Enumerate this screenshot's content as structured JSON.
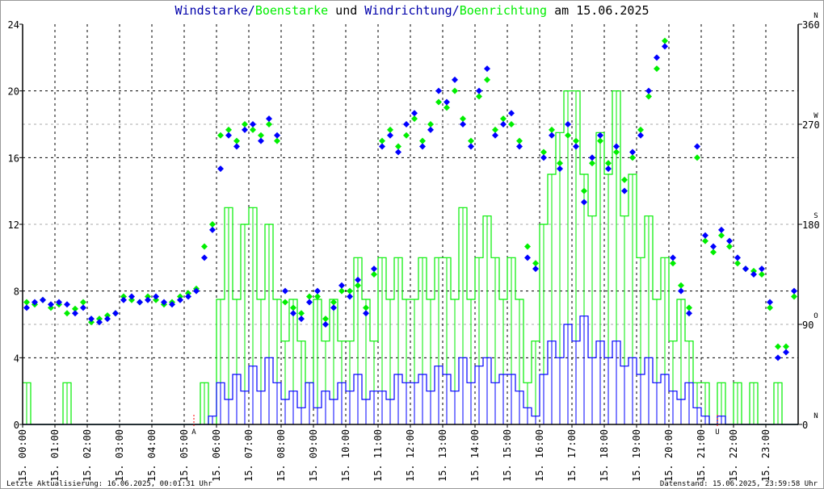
{
  "chart_data": {
    "type": "scatter",
    "title": {
      "parts": [
        {
          "text": "Windstarke",
          "color": "#0000aa"
        },
        {
          "text": "/",
          "color": "#0000aa"
        },
        {
          "text": "Boenstarke",
          "color": "#00ee00"
        },
        {
          "text": " und ",
          "color": "#000000"
        },
        {
          "text": "Windrichtung",
          "color": "#0000aa"
        },
        {
          "text": "/",
          "color": "#0000aa"
        },
        {
          "text": "Boenrichtung",
          "color": "#00ee00"
        },
        {
          "text": " am 15.06.2025",
          "color": "#000000"
        }
      ]
    },
    "x_unit": "hour",
    "xlim": [
      0,
      24
    ],
    "x_ticks": [
      "15. 00:00",
      "15. 01:00",
      "15. 02:00",
      "15. 03:00",
      "15. 04:00",
      "15. 05:00",
      "15. 06:00",
      "15. 07:00",
      "15. 08:00",
      "15. 09:00",
      "15. 10:00",
      "15. 11:00",
      "15. 12:00",
      "15. 13:00",
      "15. 14:00",
      "15. 15:00",
      "15. 16:00",
      "15. 17:00",
      "15. 18:00",
      "15. 19:00",
      "15. 20:00",
      "15. 21:00",
      "15. 22:00",
      "15. 23:00"
    ],
    "ylim_left": [
      0,
      24
    ],
    "y_ticks_left": [
      "0",
      "4",
      "8",
      "12",
      "16",
      "20",
      "24"
    ],
    "ylim_right": [
      0,
      360
    ],
    "y_ticks_right": [
      {
        "value": 0,
        "label": "0",
        "compass": "N"
      },
      {
        "value": 90,
        "label": "90",
        "compass": "O"
      },
      {
        "value": 180,
        "label": "180",
        "compass": "S"
      },
      {
        "value": 270,
        "label": "270",
        "compass": "W"
      },
      {
        "value": 360,
        "label": "360",
        "compass": "N"
      }
    ],
    "markers": [
      {
        "hour": 5.3,
        "label": "A",
        "color": "#ff0000"
      },
      {
        "hour": 21.5,
        "label": "U",
        "color": "#ff0000"
      }
    ],
    "sample_interval_minutes": 15,
    "series": [
      {
        "name": "Windstarke",
        "kind": "line",
        "axis": "left",
        "color": "#0000ff",
        "values": [
          0,
          0,
          0,
          0,
          0,
          0,
          0,
          0,
          0,
          0,
          0,
          0,
          0,
          0,
          0,
          0,
          0,
          0,
          0,
          0,
          0,
          0,
          0,
          0.5,
          2.5,
          1.5,
          3,
          2,
          3.5,
          2,
          4,
          2.5,
          1.5,
          2,
          1,
          2.5,
          1,
          2,
          1.5,
          2.5,
          2,
          3,
          1.5,
          2,
          2,
          1.5,
          3,
          2.5,
          2.5,
          3,
          2,
          3.5,
          3,
          2,
          4,
          2.5,
          3.5,
          4,
          2.5,
          3,
          3,
          2,
          1,
          0.5,
          3,
          5,
          4,
          6,
          5,
          6.5,
          4,
          5,
          4,
          5,
          3.5,
          4,
          3,
          4,
          2.5,
          3,
          2,
          1.5,
          2.5,
          1,
          0.5,
          0,
          0.5,
          0,
          0,
          0,
          0,
          0,
          0,
          0,
          0,
          0
        ]
      },
      {
        "name": "Boenstarke",
        "kind": "line",
        "axis": "left",
        "color": "#00ee00",
        "values": [
          2.5,
          0,
          0,
          0,
          0,
          2.5,
          0,
          0,
          0,
          0,
          0,
          0,
          0,
          0,
          0,
          0,
          0,
          0,
          0,
          0,
          0,
          0,
          2.5,
          0,
          7.5,
          13,
          7.5,
          12,
          13,
          7.5,
          12,
          7.5,
          5,
          7.5,
          5,
          2.5,
          7.5,
          5,
          7.5,
          5,
          5,
          10,
          7.5,
          5,
          10,
          7.5,
          10,
          7.5,
          7.5,
          10,
          7.5,
          10,
          10,
          7.5,
          13,
          7.5,
          10,
          12.5,
          10,
          7.5,
          10,
          7.5,
          2.5,
          5,
          12,
          15,
          17.5,
          20,
          20,
          15,
          12.5,
          17.5,
          15,
          20,
          12.5,
          15,
          10,
          12.5,
          7.5,
          10,
          5,
          7.5,
          5,
          2.5,
          2.5,
          0,
          2.5,
          0,
          2.5,
          0,
          2.5,
          0,
          0,
          2.5,
          0,
          0
        ]
      },
      {
        "name": "Windrichtung",
        "kind": "scatter",
        "axis": "right",
        "color": "#0000ff",
        "values": [
          105,
          110,
          112,
          108,
          110,
          108,
          100,
          105,
          95,
          92,
          95,
          100,
          112,
          115,
          110,
          112,
          115,
          110,
          108,
          112,
          115,
          120,
          150,
          175,
          230,
          260,
          250,
          265,
          270,
          255,
          275,
          260,
          120,
          100,
          95,
          110,
          120,
          90,
          105,
          125,
          115,
          130,
          100,
          140,
          250,
          260,
          245,
          270,
          280,
          250,
          265,
          300,
          290,
          310,
          270,
          250,
          300,
          320,
          260,
          270,
          280,
          250,
          150,
          140,
          240,
          260,
          230,
          270,
          250,
          200,
          240,
          260,
          230,
          250,
          210,
          245,
          260,
          300,
          330,
          340,
          150,
          120,
          100,
          250,
          170,
          160,
          175,
          165,
          150,
          140,
          135,
          140,
          110,
          60,
          65,
          120
        ]
      },
      {
        "name": "Boenrichtung",
        "kind": "scatter",
        "axis": "right",
        "color": "#00ee00",
        "values": [
          110,
          108,
          112,
          105,
          108,
          100,
          104,
          110,
          92,
          95,
          98,
          100,
          115,
          112,
          110,
          115,
          112,
          108,
          110,
          115,
          118,
          122,
          160,
          180,
          260,
          265,
          255,
          270,
          265,
          260,
          270,
          255,
          110,
          105,
          100,
          115,
          115,
          95,
          110,
          120,
          120,
          125,
          105,
          135,
          255,
          265,
          250,
          260,
          275,
          255,
          270,
          290,
          285,
          300,
          275,
          255,
          295,
          310,
          265,
          275,
          270,
          255,
          160,
          145,
          245,
          265,
          235,
          260,
          255,
          210,
          235,
          255,
          235,
          245,
          220,
          240,
          265,
          295,
          320,
          345,
          145,
          125,
          105,
          240,
          165,
          155,
          170,
          160,
          145,
          140,
          138,
          135,
          105,
          70,
          70,
          115
        ]
      }
    ]
  },
  "footer": {
    "left": "Letzte Aktualisierung: 16.06.2025, 00:01:31 Uhr",
    "right": "Datenstand: 15.06.2025, 23:59:58 Uhr"
  }
}
